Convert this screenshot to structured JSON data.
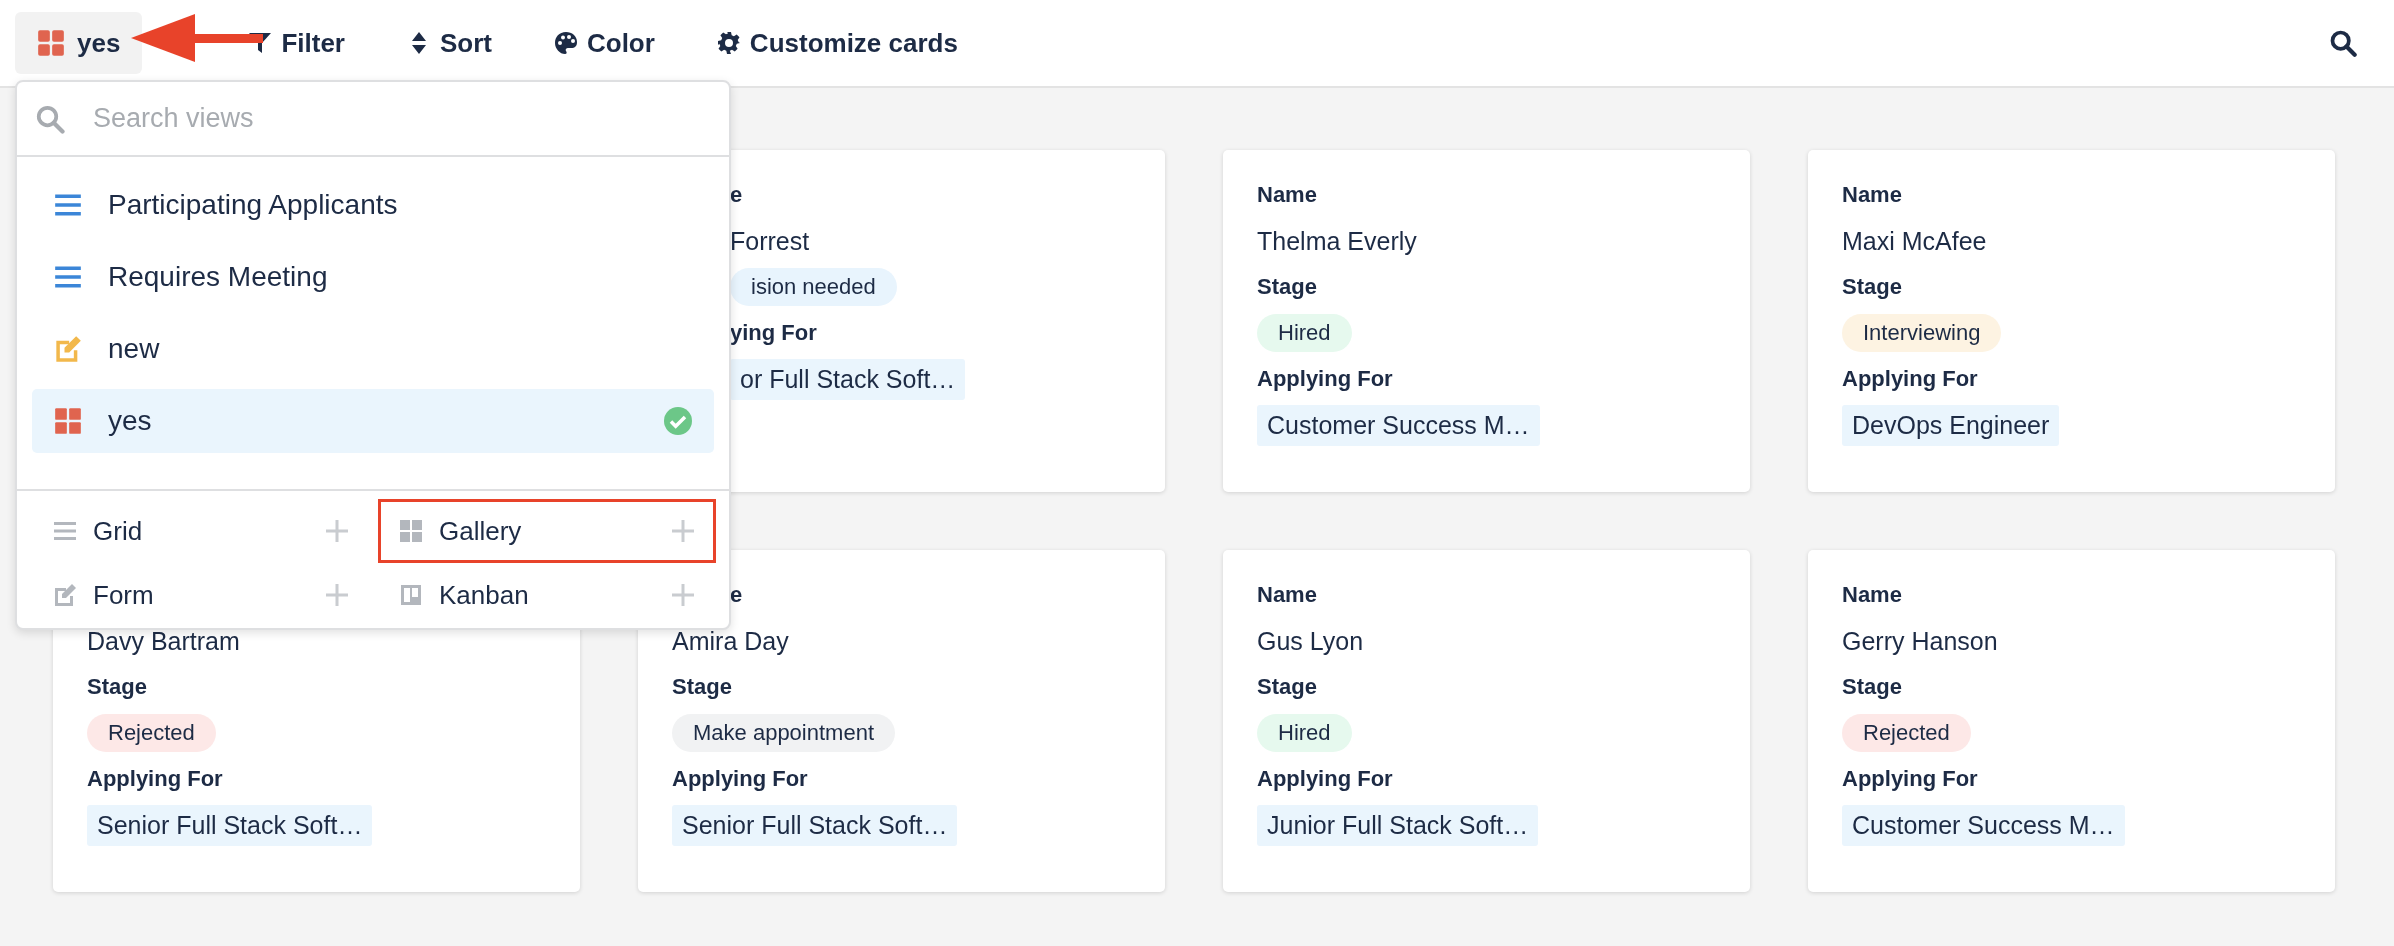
{
  "toolbar": {
    "current_view": {
      "kind": "gallery",
      "label": "yes"
    },
    "actions": [
      {
        "kind": "filter",
        "label": "Filter"
      },
      {
        "kind": "sort",
        "label": "Sort"
      },
      {
        "kind": "color",
        "label": "Color"
      },
      {
        "kind": "customize",
        "label": "Customize cards"
      }
    ]
  },
  "view_menu": {
    "search": {
      "placeholder": "Search views"
    },
    "views": [
      {
        "kind": "grid",
        "label": "Participating Applicants",
        "selected": false
      },
      {
        "kind": "grid",
        "label": "Requires Meeting",
        "selected": false
      },
      {
        "kind": "form",
        "label": "new",
        "selected": false
      },
      {
        "kind": "gallery",
        "label": "yes",
        "selected": true
      }
    ],
    "create": [
      {
        "kind": "grid",
        "label": "Grid",
        "highlighted": false
      },
      {
        "kind": "gallery",
        "label": "Gallery",
        "highlighted": true
      },
      {
        "kind": "form",
        "label": "Form",
        "highlighted": false
      },
      {
        "kind": "kanban",
        "label": "Kanban",
        "highlighted": false
      }
    ]
  },
  "cards": [
    {
      "covered_top": false,
      "fields": [
        {
          "kind": "label",
          "text": "e",
          "partial": true
        },
        {
          "kind": "value",
          "text": "Forrest",
          "partial": true
        },
        {
          "kind": "stage",
          "text": "ision needed",
          "color": "#e8f4fd",
          "partial": true
        },
        {
          "kind": "label",
          "text": "ying For",
          "partial": true
        },
        {
          "kind": "chip",
          "text": "or Full Stack Soft…",
          "partial": true
        }
      ]
    },
    {
      "covered_top": false,
      "fields": [
        {
          "kind": "label",
          "text": "Name",
          "partial": false
        },
        {
          "kind": "value",
          "text": "Thelma Everly",
          "partial": false
        },
        {
          "kind": "label",
          "text": "Stage",
          "partial": false
        },
        {
          "kind": "stage",
          "text": "Hired",
          "color": "#e6f9ee",
          "partial": false
        },
        {
          "kind": "label",
          "text": "Applying For",
          "partial": false
        },
        {
          "kind": "chip",
          "text": "Customer Success M…",
          "partial": false
        }
      ]
    },
    {
      "covered_top": false,
      "fields": [
        {
          "kind": "label",
          "text": "Name",
          "partial": false
        },
        {
          "kind": "value",
          "text": "Maxi McAfee",
          "partial": false
        },
        {
          "kind": "label",
          "text": "Stage",
          "partial": false
        },
        {
          "kind": "stage",
          "text": "Interviewing",
          "color": "#fdf3e2",
          "partial": false
        },
        {
          "kind": "label",
          "text": "Applying For",
          "partial": false
        },
        {
          "kind": "chip",
          "text": "DevOps Engineer",
          "partial": false
        }
      ]
    },
    {
      "covered_top": true,
      "fields": [
        {
          "kind": "value",
          "text": "Davy Bartram",
          "partial": false
        },
        {
          "kind": "label",
          "text": "Stage",
          "partial": false
        },
        {
          "kind": "stage",
          "text": "Rejected",
          "color": "#fde8e7",
          "partial": false
        },
        {
          "kind": "label",
          "text": "Applying For",
          "partial": false
        },
        {
          "kind": "chip",
          "text": "Senior Full Stack Soft…",
          "partial": false
        }
      ]
    },
    {
      "covered_top": false,
      "fields": [
        {
          "kind": "label",
          "text": "e",
          "partial": true
        },
        {
          "kind": "value",
          "text": "Amira Day",
          "partial": false
        },
        {
          "kind": "label",
          "text": "Stage",
          "partial": false
        },
        {
          "kind": "stage",
          "text": "Make appointment",
          "color": "#f1f2f3",
          "partial": false
        },
        {
          "kind": "label",
          "text": "Applying For",
          "partial": false
        },
        {
          "kind": "chip",
          "text": "Senior Full Stack Soft…",
          "partial": false
        }
      ]
    },
    {
      "covered_top": false,
      "fields": [
        {
          "kind": "label",
          "text": "Name",
          "partial": false
        },
        {
          "kind": "value",
          "text": "Gus Lyon",
          "partial": false
        },
        {
          "kind": "label",
          "text": "Stage",
          "partial": false
        },
        {
          "kind": "stage",
          "text": "Hired",
          "color": "#e6f9ee",
          "partial": false
        },
        {
          "kind": "label",
          "text": "Applying For",
          "partial": false
        },
        {
          "kind": "chip",
          "text": "Junior Full Stack Soft…",
          "partial": false
        }
      ]
    },
    {
      "covered_top": false,
      "fields": [
        {
          "kind": "label",
          "text": "Name",
          "partial": false
        },
        {
          "kind": "value",
          "text": "Gerry Hanson",
          "partial": false
        },
        {
          "kind": "label",
          "text": "Stage",
          "partial": false
        },
        {
          "kind": "stage",
          "text": "Rejected",
          "color": "#fde8e7",
          "partial": false
        },
        {
          "kind": "label",
          "text": "Applying For",
          "partial": false
        },
        {
          "kind": "chip",
          "text": "Customer Success M…",
          "partial": false
        }
      ]
    }
  ]
}
